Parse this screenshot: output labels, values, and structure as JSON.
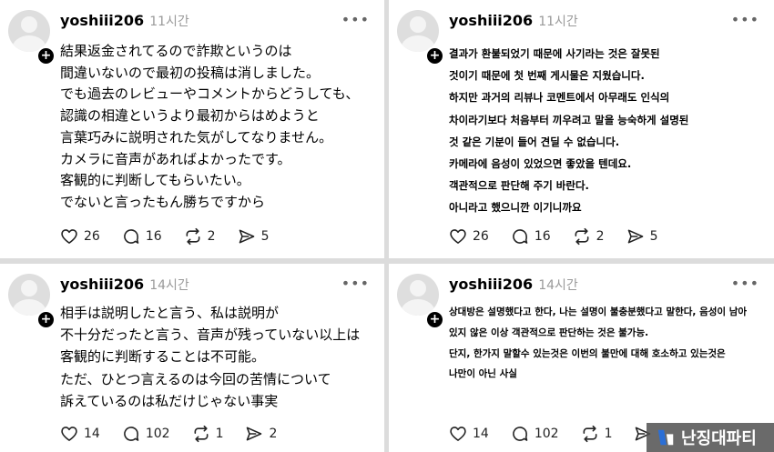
{
  "posts": [
    {
      "username": "yoshiii206",
      "time": "11시간",
      "lines": [
        "結果返金されてるので詐欺というのは",
        "間違いないので最初の投稿は消しました。",
        "でも過去のレビューやコメントからどうしても、",
        "認識の相違というより最初からはめようと",
        "言葉巧みに説明された気がしてなりません。",
        "カメラに音声があればよかったです。",
        "客観的に判断してもらいたい。",
        "でないと言ったもん勝ちですから"
      ],
      "likes": "26",
      "comments": "16",
      "reposts": "2",
      "shares": "5"
    },
    {
      "username": "yoshiii206",
      "time": "11시간",
      "lines": [
        "결과가 환불되었기 때문에 사기라는 것은 잘못된",
        "것이기 때문에 첫 번째 게시물은 지웠습니다.",
        "하지만 과거의 리뷰나 코멘트에서 아무래도 인식의",
        "차이라기보다 처음부터 끼우려고 말을 능숙하게 설명된",
        "것 같은 기분이 들어 견딜 수 없습니다.",
        "카메라에 음성이 있었으면 좋았을 텐데요.",
        "객관적으로 판단해 주기 바란다.",
        "아니라고 했으니깐 이기니까요"
      ],
      "likes": "26",
      "comments": "16",
      "reposts": "2",
      "shares": "5"
    },
    {
      "username": "yoshiii206",
      "time": "14시간",
      "lines": [
        "相手は説明したと言う、私は説明が",
        "不十分だったと言う、音声が残っていない以上は",
        "客観的に判断することは不可能。",
        "ただ、ひとつ言えるのは今回の苦情について",
        "訴えているのは私だけじゃない事実"
      ],
      "likes": "14",
      "comments": "102",
      "reposts": "1",
      "shares": "2"
    },
    {
      "username": "yoshiii206",
      "time": "14시간",
      "lines": [
        "상대방은 설명했다고 한다, 나는 설명이 불충분했다고 말한다, 음성이 남아",
        "있지 않은 이상 객관적으로 판단하는 것은 불가능.",
        "단지, 한가지 말할수 있는것은 이번의 불만에 대해 호소하고 있는것은",
        "나만이 아닌 사실"
      ],
      "likes": "14",
      "comments": "102",
      "reposts": "1",
      "shares": ""
    }
  ],
  "watermark": "난징대파티",
  "icons": {
    "like": "heart-icon",
    "comment": "comment-bubble-icon",
    "repost": "repost-icon",
    "share": "send-icon",
    "more": "more-dots-icon"
  }
}
